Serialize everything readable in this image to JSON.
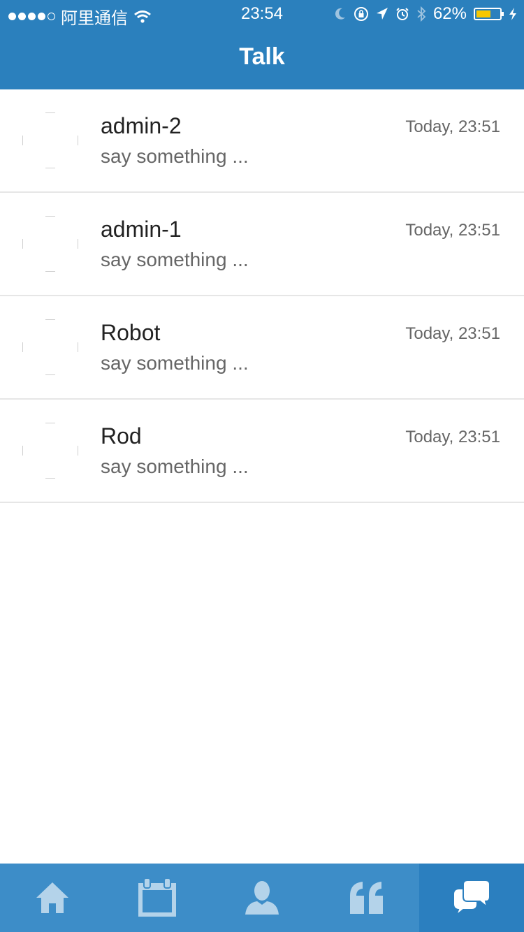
{
  "status_bar": {
    "carrier": "阿里通信",
    "time": "23:54",
    "battery": "62%",
    "battery_level": 0.62
  },
  "header": {
    "title": "Talk"
  },
  "conversations": [
    {
      "name": "admin-2",
      "preview": "say something ...",
      "time": "Today, 23:51"
    },
    {
      "name": "admin-1",
      "preview": "say something ...",
      "time": "Today, 23:51"
    },
    {
      "name": "Robot",
      "preview": "say something ...",
      "time": "Today, 23:51"
    },
    {
      "name": "Rod",
      "preview": "say something ...",
      "time": "Today, 23:51"
    }
  ],
  "tabbar": {
    "items": [
      {
        "icon": "home-icon"
      },
      {
        "icon": "calendar-icon"
      },
      {
        "icon": "person-icon"
      },
      {
        "icon": "quote-icon"
      },
      {
        "icon": "chat-icon",
        "active": true
      }
    ]
  },
  "colors": {
    "header_bg": "#2b80bd",
    "tabbar_bg": "#3d8dc8",
    "tabbar_active_bg": "#2b7fbf",
    "tab_icon": "#b4d3ea",
    "tab_icon_active": "#ffffff",
    "battery_fill": "#f6c700"
  }
}
